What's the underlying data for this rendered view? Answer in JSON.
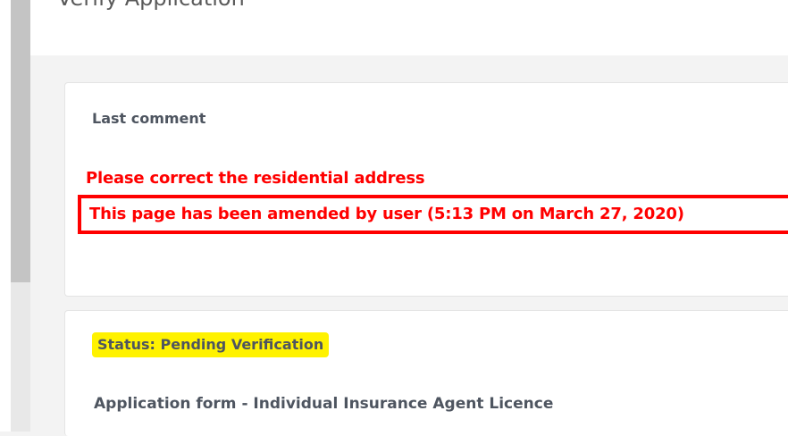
{
  "header": {
    "title": "Verify Application"
  },
  "comment_card": {
    "heading": "Last comment",
    "comment": "Please correct the residential address",
    "amendment_note": "This page has been amended by user (5:13 PM on March 27, 2020)"
  },
  "status_card": {
    "status_badge": "Status: Pending Verification",
    "form_title": "Application form - Individual Insurance Agent Licence"
  },
  "colors": {
    "alert_red": "#ff0000",
    "highlight_yellow": "#fff200",
    "text_gray": "#4e5560",
    "background": "#f3f3f3"
  }
}
